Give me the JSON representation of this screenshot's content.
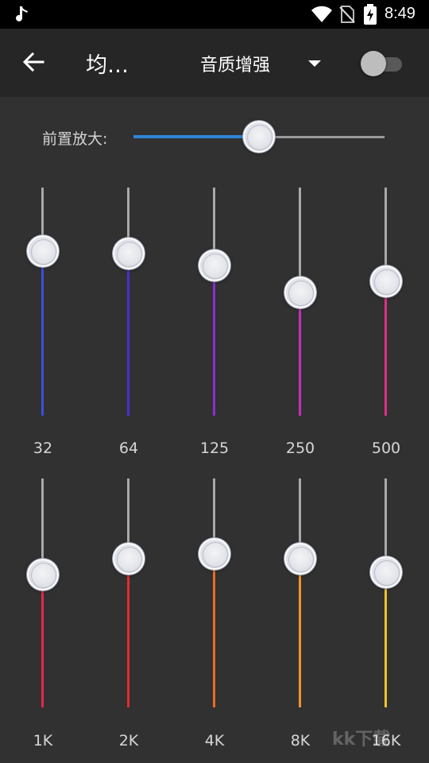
{
  "status_bar": {
    "time": "8:49",
    "icons": [
      "music-note-icon",
      "wifi-icon",
      "no-sim-icon",
      "battery-charging-icon"
    ]
  },
  "app_bar": {
    "title": "均…",
    "preset": "音质增强",
    "toggle_on": false
  },
  "preamp": {
    "label": "前置放大:",
    "level": 0.5,
    "fill_color": "#2f86d8"
  },
  "bands": [
    {
      "label": "32",
      "level": 0.72,
      "color": "#3a50e0"
    },
    {
      "label": "64",
      "level": 0.71,
      "color": "#4b2fd2"
    },
    {
      "label": "125",
      "level": 0.66,
      "color": "#8a2cd8"
    },
    {
      "label": "250",
      "level": 0.54,
      "color": "#c52fbc"
    },
    {
      "label": "500",
      "level": 0.59,
      "color": "#e02f88"
    },
    {
      "label": "1K",
      "level": 0.58,
      "color": "#e2284f"
    },
    {
      "label": "2K",
      "level": 0.65,
      "color": "#e22c2c"
    },
    {
      "label": "4K",
      "level": 0.67,
      "color": "#ec6a23"
    },
    {
      "label": "8K",
      "level": 0.65,
      "color": "#f0952b"
    },
    {
      "label": "16K",
      "level": 0.59,
      "color": "#f2c22e"
    }
  ],
  "watermark": "kk下载"
}
